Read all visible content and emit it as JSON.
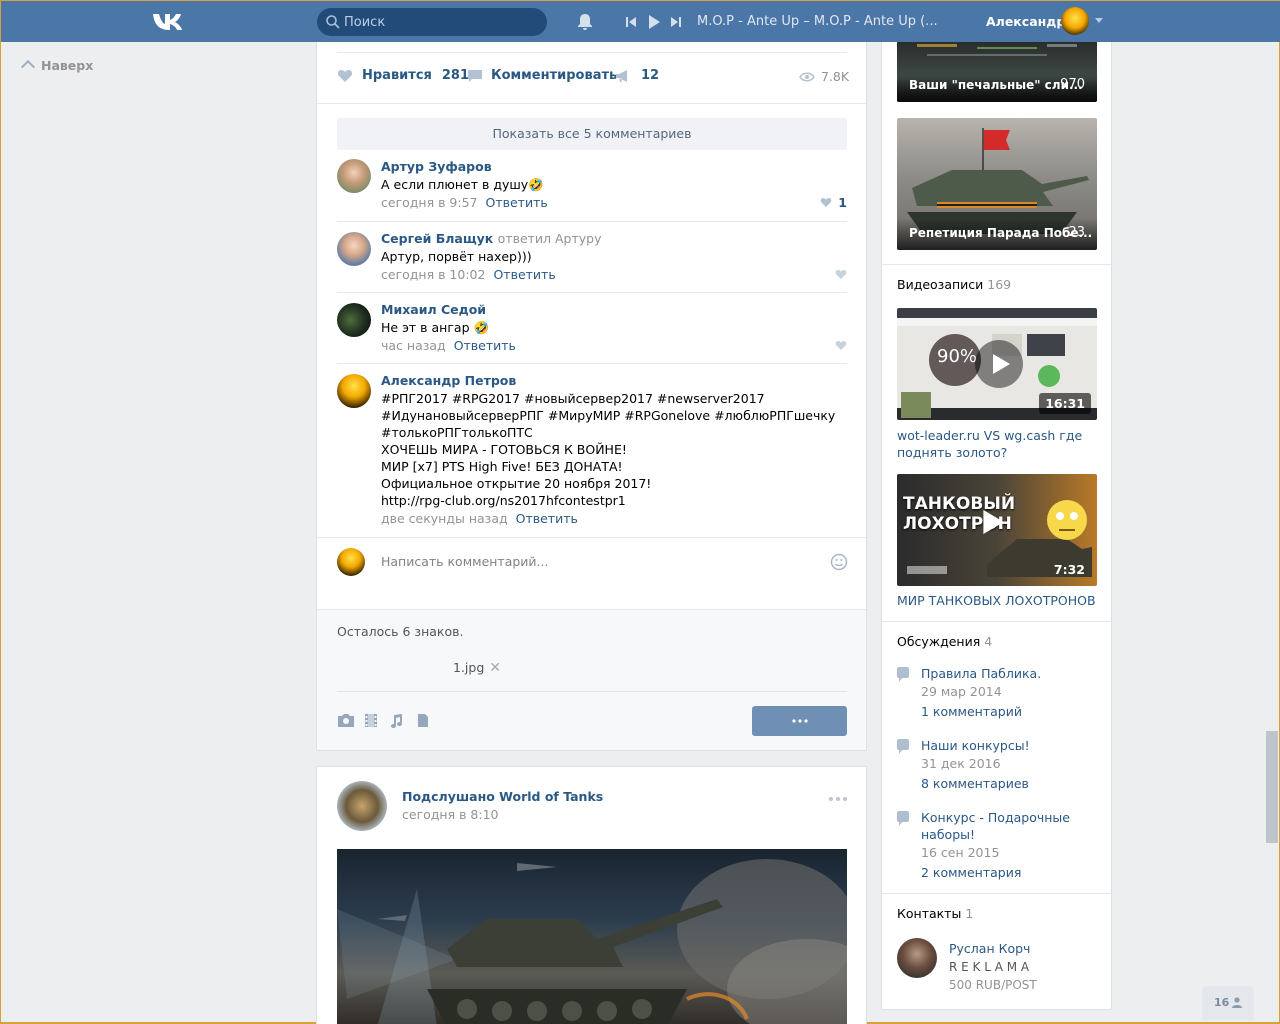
{
  "header": {
    "search_placeholder": "Поиск",
    "track": "M.O.P - Ante Up – M.O.P - Ante Up (...",
    "user_name": "Александр"
  },
  "left": {
    "up_label": "Наверх"
  },
  "post1": {
    "likes_label": "Нравится",
    "likes_count": "281",
    "comment_label": "Комментировать",
    "shares_count": "12",
    "views": "7.8K",
    "show_all": "Показать все 5 комментариев",
    "comments": [
      {
        "author": "Артур Зуфаров",
        "reply_to": "",
        "text": "А если плюнет в душу🤣",
        "time": "сегодня в 9:57",
        "reply": "Ответить",
        "likes": "1"
      },
      {
        "author": "Сергей Блащук",
        "reply_to": "ответил Артуру",
        "text": "Артур, порвёт нахер)))",
        "time": "сегодня в 10:02",
        "reply": "Ответить",
        "likes": ""
      },
      {
        "author": "Михаил Седой",
        "reply_to": "",
        "text": "Не эт в ангар 🤣",
        "time": "час назад",
        "reply": "Ответить",
        "likes": ""
      },
      {
        "author": "Александр Петров",
        "reply_to": "",
        "text": "#РПГ2017 #RPG2017 #новыйсервер2017 #newserver2017\n#ИдунановыйсерверРПГ #МируМИР #RPGonelove #люблюРПГшечку\n#толькоРПГтолькоПТС\nХОЧЕШЬ МИРА - ГОТОВЬСЯ К ВОЙНЕ!\nМИР [x7] PTS High Five! БЕЗ ДОНАТА!\nОфициальное открытие 20 ноября 2017!\nhttp://rpg-club.org/ns2017hfcontestpr1",
        "time": "две секунды назад",
        "reply": "Ответить",
        "likes": ""
      }
    ],
    "new_comment_placeholder": "Написать комментарий...",
    "chars_left": "Осталось 6 знаков.",
    "attachment": "1.jpg"
  },
  "post2": {
    "author": "Подслушано World of Tanks",
    "time": "сегодня в 8:10"
  },
  "right": {
    "photos": [
      {
        "title": "Ваши \"печальные\" сли...",
        "count": "970"
      },
      {
        "title": "Репетиция Парада Побе...",
        "count": "23"
      }
    ],
    "videos_label": "Видеозаписи",
    "videos_count": "169",
    "videos": [
      {
        "title": "wot-leader.ru VS wg.cash где поднять золото?",
        "duration": "16:31",
        "overlay": "90%"
      },
      {
        "title": "МИР ТАНКОВЫХ ЛОХОТРОНОВ",
        "duration": "7:32",
        "overlay": "ТАНКОВЫЙ ЛОХОТРОН"
      }
    ],
    "discussions_label": "Обсуждения",
    "discussions_count": "4",
    "discussions": [
      {
        "title": "Правила Паблика.",
        "date": "29 мар 2014",
        "comments": "1 комментарий"
      },
      {
        "title": "Наши конкурсы!",
        "date": "31 дек 2016",
        "comments": "8 комментариев"
      },
      {
        "title": "Конкурс - Подарочные наборы!",
        "date": "16 сен 2015",
        "comments": "2 комментария"
      }
    ],
    "contacts_label": "Контакты",
    "contacts_count": "1",
    "contact": {
      "name": "Руслан Корч",
      "role": "R E K L A M A",
      "price": "500 RUB/POST"
    }
  },
  "online_count": "16"
}
